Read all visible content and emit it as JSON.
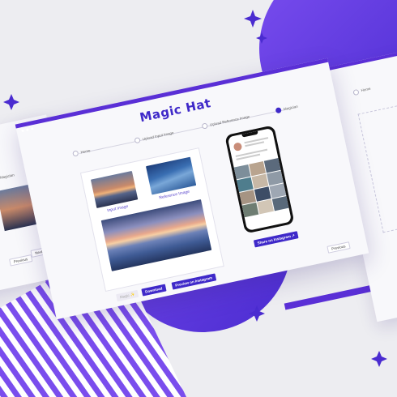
{
  "app": {
    "logo_text": "Magic Hat"
  },
  "steps": [
    {
      "label": "Home",
      "active": false
    },
    {
      "label": "Upload Input Image",
      "active": false
    },
    {
      "label": "Upload Reference Image",
      "active": false
    },
    {
      "label": "Magician",
      "active": true
    }
  ],
  "images": {
    "input_label": "Input Image",
    "reference_label": "Reference Image"
  },
  "buttons": {
    "magic": "Magic ✨",
    "download": "Download",
    "preview": "Preview on Instagram",
    "share": "Share on Instagram ↗",
    "previous": "Previous"
  },
  "side_left": {
    "step_label": "Magician",
    "previous": "Previous",
    "next": "Next"
  },
  "side_right": {
    "step_label": "Home"
  },
  "colors": {
    "brand": "#3f29c9",
    "accent": "#5a2fd6",
    "background": "#ededf1"
  }
}
